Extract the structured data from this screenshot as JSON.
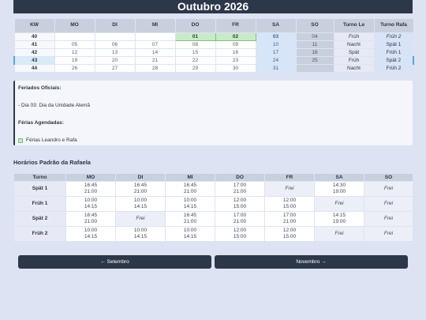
{
  "title": "Outubro 2026",
  "calendar": {
    "headers": [
      "KW",
      "MO",
      "DI",
      "MI",
      "DO",
      "FR",
      "SA",
      "SO",
      "Turno Le",
      "Turno Rafa"
    ],
    "rows": [
      {
        "kw": "40",
        "days": [
          "",
          "",
          "",
          "01",
          "02",
          "03",
          "04"
        ],
        "le": "Früh",
        "rafa": "Früh 2"
      },
      {
        "kw": "41",
        "days": [
          "05",
          "06",
          "07",
          "08",
          "09",
          "10",
          "11"
        ],
        "le": "Nacht",
        "rafa": "Spät 1"
      },
      {
        "kw": "42",
        "days": [
          "12",
          "13",
          "14",
          "15",
          "16",
          "17",
          "18"
        ],
        "le": "Spät",
        "rafa": "Früh 1"
      },
      {
        "kw": "43",
        "days": [
          "19",
          "20",
          "21",
          "22",
          "23",
          "24",
          "25"
        ],
        "le": "Früh",
        "rafa": "Spät 2"
      },
      {
        "kw": "44",
        "days": [
          "26",
          "27",
          "28",
          "29",
          "30",
          "31",
          ""
        ],
        "le": "Nacht",
        "rafa": "Früh 2"
      }
    ]
  },
  "info": {
    "holidays_title": "Feriados Oficiais:",
    "holiday_item": "- Dia 03: Dia da Unidade Alemã",
    "vacation_title": "Férias Agendadas:",
    "vacation_legend": "Férias Leandro e Rafa",
    "colors": {
      "holiday": "#c8eac8",
      "accent": "#2c3749"
    }
  },
  "schedule": {
    "title": "Horários Padrão da Rafaela",
    "headers": [
      "Turno",
      "MO",
      "DI",
      "MI",
      "DO",
      "FR",
      "SA",
      "SO"
    ],
    "rows": [
      {
        "turno": "Spät 1",
        "cells": [
          [
            "16:45",
            "21:00"
          ],
          [
            "16:45",
            "21:00"
          ],
          [
            "16:45",
            "21:00"
          ],
          [
            "17:00",
            "21:00"
          ],
          [
            "Frei"
          ],
          [
            "14:30",
            "19:00"
          ],
          [
            "Frei"
          ]
        ]
      },
      {
        "turno": "Früh 1",
        "cells": [
          [
            "10:00",
            "14:15"
          ],
          [
            "10:00",
            "14:15"
          ],
          [
            "10:00",
            "14:15"
          ],
          [
            "12:00",
            "15:00"
          ],
          [
            "12:00",
            "15:00"
          ],
          [
            "Frei"
          ],
          [
            "Frei"
          ]
        ]
      },
      {
        "turno": "Spät 2",
        "cells": [
          [
            "16:45",
            "21:00"
          ],
          [
            "Frei"
          ],
          [
            "16:45",
            "21:00"
          ],
          [
            "17:00",
            "21:00"
          ],
          [
            "17:00",
            "21:00"
          ],
          [
            "14:15",
            "19:00"
          ],
          [
            "Frei"
          ]
        ]
      },
      {
        "turno": "Früh 2",
        "cells": [
          [
            "10:00",
            "14:15"
          ],
          [
            "10:00",
            "14:15"
          ],
          [
            "10:00",
            "14:15"
          ],
          [
            "12:00",
            "15:00"
          ],
          [
            "12:00",
            "15:00"
          ],
          [
            "Frei"
          ],
          [
            "Frei"
          ]
        ]
      }
    ]
  },
  "nav": {
    "prev": "← Setembro",
    "next": "Novembro →"
  }
}
